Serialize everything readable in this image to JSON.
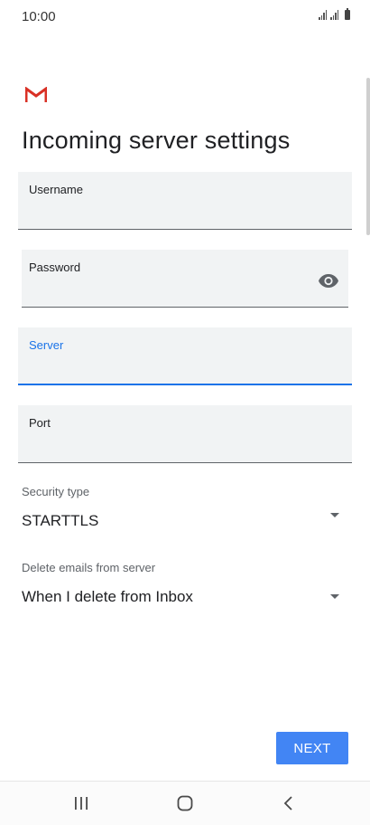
{
  "status_bar": {
    "time": "10:00"
  },
  "app": {
    "logo": "gmail-logo",
    "title": "Incoming server settings"
  },
  "form": {
    "username": {
      "label": "Username",
      "value": ""
    },
    "password": {
      "label": "Password",
      "value": "",
      "icon": "eye-icon"
    },
    "server": {
      "label": "Server",
      "value": ""
    },
    "port": {
      "label": "Port",
      "value": ""
    },
    "security_type": {
      "label": "Security type",
      "value": "STARTTLS"
    },
    "delete_emails": {
      "label": "Delete emails from server",
      "value": "When I delete from Inbox"
    }
  },
  "actions": {
    "next_label": "NEXT"
  },
  "nav": {
    "recents_icon": "recents-icon",
    "home_icon": "home-icon",
    "back_icon": "back-icon"
  },
  "colors": {
    "accent": "#1a73e8",
    "button": "#4285f4",
    "gmail_red": "#d93025",
    "field_bg": "#f1f3f4"
  }
}
